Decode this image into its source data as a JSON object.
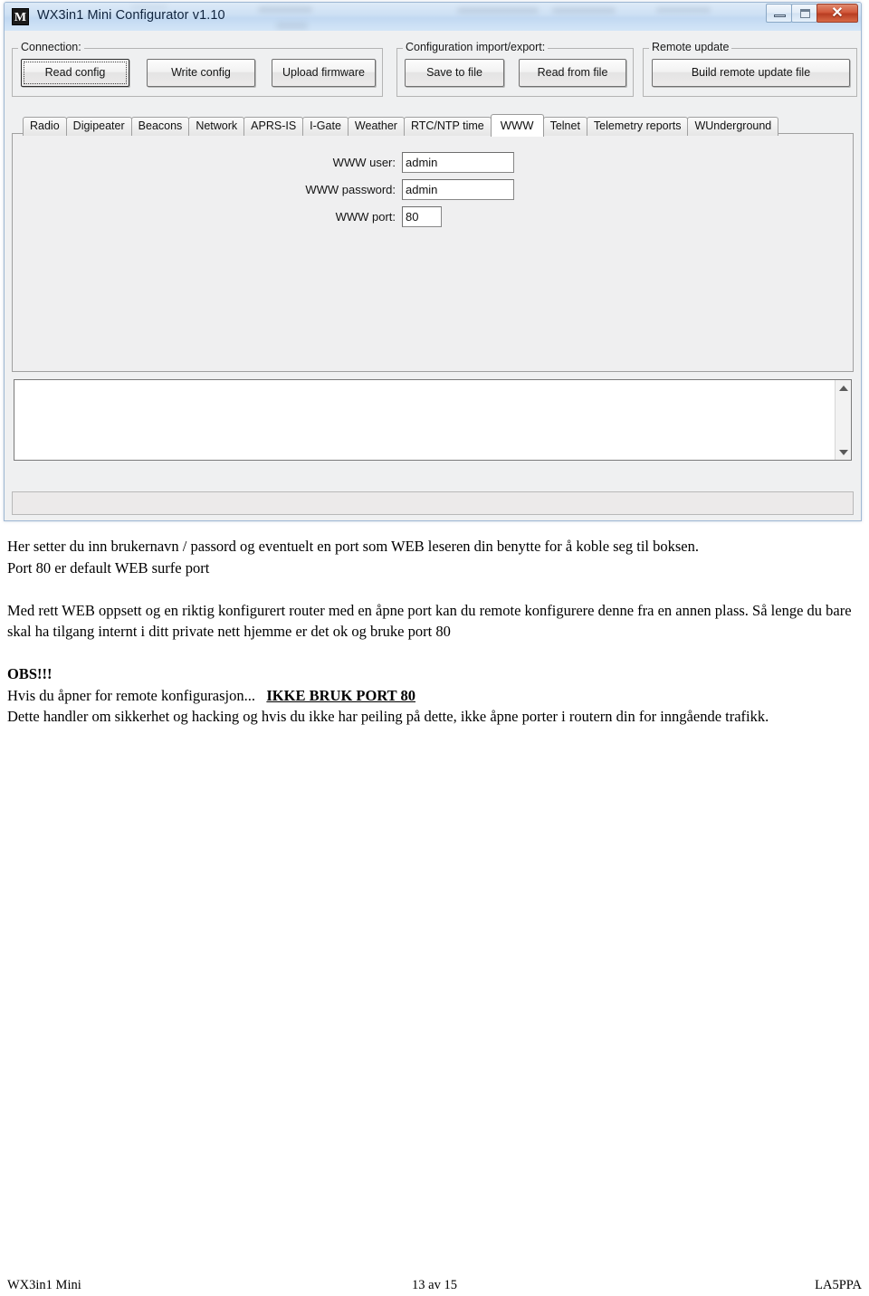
{
  "window": {
    "title": "WX3in1 Mini Configurator v1.10",
    "icon": "M",
    "controls": {
      "minimize": "minimize-button",
      "maximize": "maximize-button",
      "close": "✕"
    }
  },
  "groups": [
    {
      "id": "connection",
      "label": "Connection:",
      "buttons": [
        {
          "id": "read-config",
          "label": "Read config",
          "focused": true
        },
        {
          "id": "write-config",
          "label": "Write config",
          "focused": false
        },
        {
          "id": "upload-firmware",
          "label": "Upload firmware",
          "focused": false
        }
      ]
    },
    {
      "id": "import-export",
      "label": "Configuration import/export:",
      "buttons": [
        {
          "id": "save-to-file",
          "label": "Save to file",
          "focused": false
        },
        {
          "id": "read-from-file",
          "label": "Read from file",
          "focused": false
        }
      ]
    },
    {
      "id": "remote-update",
      "label": "Remote update",
      "buttons": [
        {
          "id": "build-remote-update-file",
          "label": "Build remote update file",
          "focused": false
        }
      ]
    }
  ],
  "tabs": [
    {
      "id": "radio",
      "label": "Radio",
      "selected": false
    },
    {
      "id": "digipeater",
      "label": "Digipeater",
      "selected": false
    },
    {
      "id": "beacons",
      "label": "Beacons",
      "selected": false
    },
    {
      "id": "network",
      "label": "Network",
      "selected": false
    },
    {
      "id": "aprs-is",
      "label": "APRS-IS",
      "selected": false
    },
    {
      "id": "i-gate",
      "label": "I-Gate",
      "selected": false
    },
    {
      "id": "weather",
      "label": "Weather",
      "selected": false
    },
    {
      "id": "rtc-ntp-time",
      "label": "RTC/NTP time",
      "selected": false
    },
    {
      "id": "www",
      "label": "WWW",
      "selected": true
    },
    {
      "id": "telnet",
      "label": "Telnet",
      "selected": false
    },
    {
      "id": "telemetry-reports",
      "label": "Telemetry reports",
      "selected": false
    },
    {
      "id": "wunderground",
      "label": "WUnderground",
      "selected": false
    }
  ],
  "www_form": {
    "fields": [
      {
        "id": "www-user",
        "label": "WWW user:",
        "value": "admin"
      },
      {
        "id": "www-password",
        "label": "WWW password:",
        "value": "admin"
      },
      {
        "id": "www-port",
        "label": "WWW port:",
        "value": "80"
      }
    ]
  },
  "log": {
    "text": "",
    "scrollbar": {
      "up": "scroll-up-arrow",
      "down": "scroll-down-arrow"
    }
  },
  "status": {
    "text": ""
  },
  "document": {
    "paragraphs": [
      {
        "type": "plain",
        "text": "Her setter du inn brukernavn / passord og eventuelt en port som WEB leseren din benytte for å koble seg til boksen."
      },
      {
        "type": "plain",
        "text": "Port 80 er default WEB surfe port"
      },
      {
        "type": "blank",
        "text": ""
      },
      {
        "type": "plain",
        "text": "Med rett WEB oppsett og en riktig konfigurert router med en åpne port kan du remote konfigurere denne fra en annen plass. Så lenge du bare skal ha tilgang internt i ditt private nett hjemme er det ok og bruke port 80"
      },
      {
        "type": "blank",
        "text": ""
      },
      {
        "type": "bold",
        "text": "OBS!!!"
      },
      {
        "type": "mixed",
        "text": "Hvis du åpner for remote konfigurasjon...",
        "emphasis": "IKKE BRUK PORT 80"
      },
      {
        "type": "plain",
        "text": "Dette handler om sikkerhet og hacking og hvis du ikke har peiling på dette, ikke åpne porter i routern din for inngående trafikk."
      }
    ]
  },
  "footer": {
    "left": "WX3in1 Mini",
    "center": "13 av 15",
    "right": "LA5PPA"
  }
}
